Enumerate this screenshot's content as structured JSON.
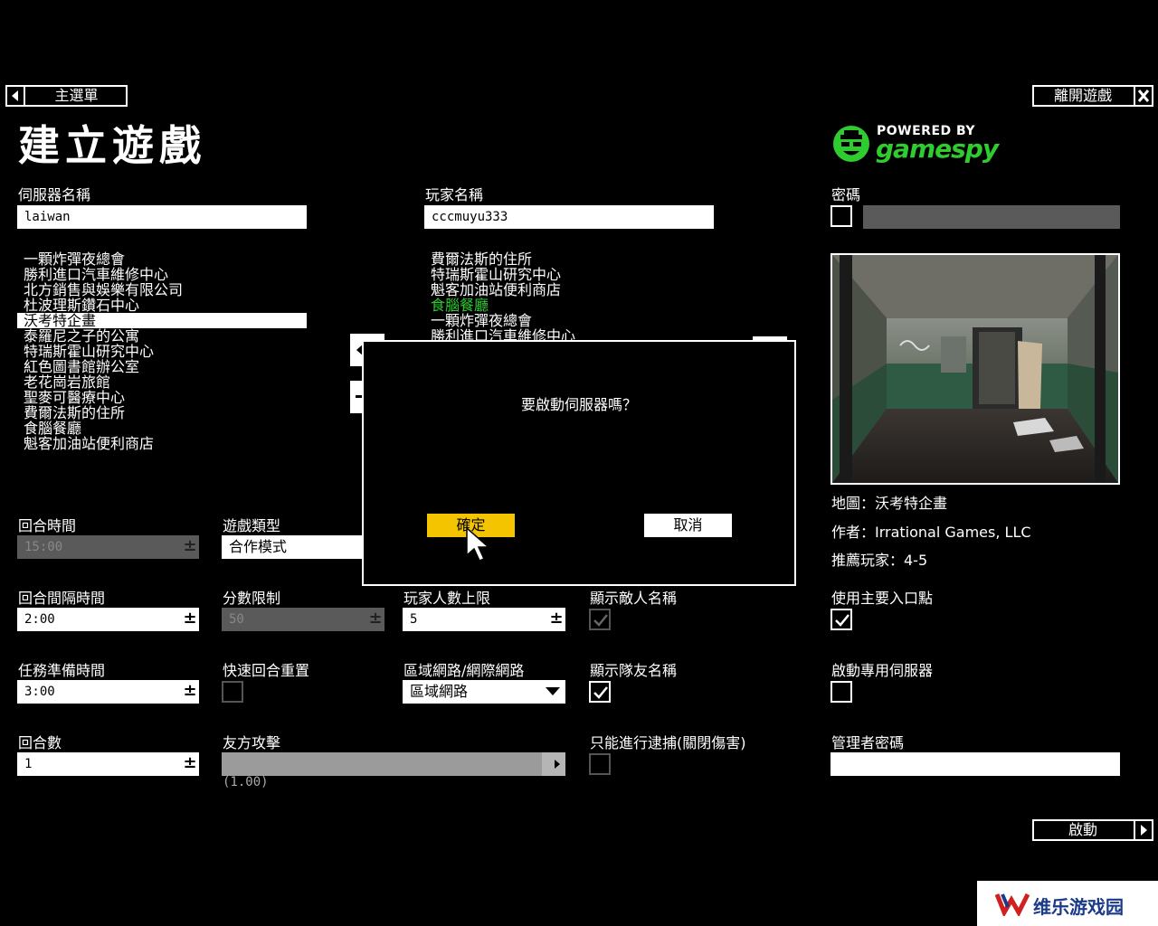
{
  "nav": {
    "back_label": "主選單",
    "exit_label": "離開遊戲"
  },
  "page_title": "建立遊戲",
  "logo": {
    "line1": "POWERED BY",
    "line2": "gamespy"
  },
  "server_name": {
    "label": "伺服器名稱",
    "value": "laiwan"
  },
  "player_name": {
    "label": "玩家名稱",
    "value": "cccmuyu333"
  },
  "password": {
    "label": "密碼"
  },
  "available_maps": [
    "一顆炸彈夜總會",
    "勝利進口汽車維修中心",
    "北方銷售與娛樂有限公司",
    "杜波理斯鑽石中心",
    "沃考特企畫",
    "泰羅尼之子的公寓",
    "特瑞斯霍山研究中心",
    "紅色圖書館辦公室",
    "老花崗岩旅館",
    "聖麥可醫療中心",
    "費爾法斯的住所",
    "食腦餐廳",
    "魁客加油站便利商店"
  ],
  "selected_available": "沃考特企畫",
  "rotation_maps": [
    "費爾法斯的住所",
    "特瑞斯霍山研究中心",
    "魁客加油站便利商店",
    "食腦餐廳",
    "一顆炸彈夜總會",
    "勝利進口汽車維修中心"
  ],
  "highlighted_rotation": "食腦餐廳",
  "map_info": {
    "map": "地圖：沃考特企畫",
    "author": "作者：Irrational Games, LLC",
    "players": "推薦玩家：4-5"
  },
  "round_time": {
    "label": "回合時間",
    "value": "15:00"
  },
  "game_type": {
    "label": "遊戲類型",
    "value": "合作模式"
  },
  "round_interval": {
    "label": "回合間隔時間",
    "value": "2:00"
  },
  "score_limit": {
    "label": "分數限制",
    "value": "50"
  },
  "max_players": {
    "label": "玩家人數上限",
    "value": "5"
  },
  "show_enemy_names": {
    "label": "顯示敵人名稱",
    "checked": true
  },
  "use_primary_entry": {
    "label": "使用主要入口點",
    "checked": true
  },
  "mission_prep": {
    "label": "任務準備時間",
    "value": "3:00"
  },
  "quick_round_reset": {
    "label": "快速回合重置",
    "checked": false
  },
  "network": {
    "label": "區域網路/網際網路",
    "value": "區域網路"
  },
  "show_team_names": {
    "label": "顯示隊友名稱",
    "checked": true
  },
  "dedicated_server": {
    "label": "啟動專用伺服器",
    "checked": false
  },
  "rounds": {
    "label": "回合數",
    "value": "1"
  },
  "friendly_fire": {
    "label": "友方攻擊",
    "value": "(1.00)"
  },
  "arrest_only": {
    "label": "只能進行逮捕(關閉傷害)",
    "checked": false
  },
  "admin_password": {
    "label": "管理者密碼",
    "value": ""
  },
  "start_label": "啟動",
  "dialog": {
    "message": "要啟動伺服器嗎？",
    "ok": "確定",
    "cancel": "取消"
  },
  "watermark": "维乐游戏园",
  "colors": {
    "accent_yellow": "#f5c400",
    "highlight_green": "#2ecc2e",
    "disabled_gray": "#5a5a5a"
  }
}
